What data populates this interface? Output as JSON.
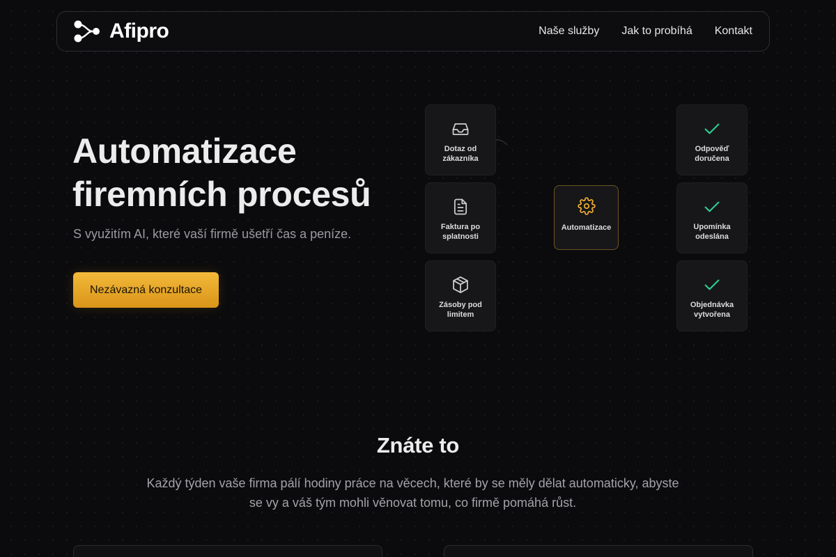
{
  "brand": {
    "name": "Afipro"
  },
  "nav": {
    "links": [
      "Naše služby",
      "Jak to probíhá",
      "Kontakt"
    ]
  },
  "hero": {
    "title_line1": "Automatizace",
    "title_line2": "firemních procesů",
    "subtitle": "S využitím AI, které vaší firmě ušetří čas a peníze.",
    "cta_label": "Nezávazná konzultace"
  },
  "diagram": {
    "inputs": [
      {
        "icon": "inbox-icon",
        "label": "Dotaz od zákazníka"
      },
      {
        "icon": "document-icon",
        "label": "Faktura po splatnosti"
      },
      {
        "icon": "package-icon",
        "label": "Zásoby pod limitem"
      }
    ],
    "center": {
      "icon": "gear-icon",
      "label": "Automatizace"
    },
    "outputs": [
      {
        "icon": "check-icon",
        "label": "Odpověď doručena"
      },
      {
        "icon": "check-icon",
        "label": "Upomínka odeslána"
      },
      {
        "icon": "check-icon",
        "label": "Objednávka vytvořena"
      }
    ]
  },
  "section": {
    "title": "Znáte to",
    "text": "Každý týden vaše firma pálí hodiny práce na věcech, které by se měly dělat automaticky, abyste se vy a váš tým mohli věnovat tomu, co firmě pomáhá růst."
  },
  "colors": {
    "background": "#0b0b0d",
    "accent": "#f0ae30",
    "check": "#2fcf8f"
  }
}
